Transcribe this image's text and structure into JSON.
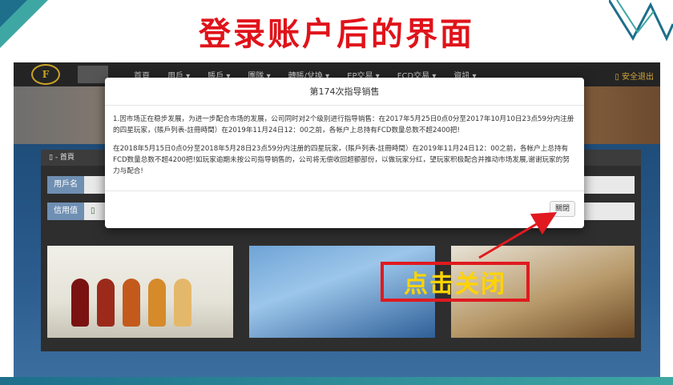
{
  "slide": {
    "title": "登录账户后的界面",
    "annotation": "点击关闭",
    "colors": {
      "title": "#e0131a",
      "annotation_border": "#e01a1f",
      "annotation_text": "#ffd400"
    }
  },
  "app": {
    "logo_text": "F",
    "nav_items": [
      "首頁",
      "用戶 ▾",
      "賬戶 ▾",
      "團隊 ▾",
      "轉賬/兌換 ▾",
      "EP交易 ▾",
      "FCD交易 ▾",
      "資訊 ▾"
    ],
    "logout": "▯ 安全退出",
    "panel_title": "▯ - 首頁",
    "fields": [
      {
        "label": "用戶名",
        "value": ""
      },
      {
        "label": "信用值",
        "value": "▯"
      }
    ]
  },
  "modal": {
    "title": "第174次指导销售",
    "paragraph_1": "1.因市场正在稳步发展，为进一步配合市场的发展，公司同时对2个级别进行指导销售：在2017年5月25日0点0分至2017年10月10日23点59分内注册的四星玩家，(賬戶列表-註冊時間）在2019年11月24日12：00之前，各帐户上总持有FCD数量总数不超2400把!",
    "paragraph_2": "在2018年5月15日0点0分至2018年5月28日23点59分内注册的四星玩家，(賬戶列表-註冊時間）在2019年11月24日12：00之前，各帐户上总持有FCD数量总数不超4200把!如玩家逾期未按公司指导销售的，公司将无偿收回超额部份，以做玩家分红，望玩家积极配合并推动市场发展,谢谢玩家的努力与配合!",
    "close_label": "關閉"
  }
}
